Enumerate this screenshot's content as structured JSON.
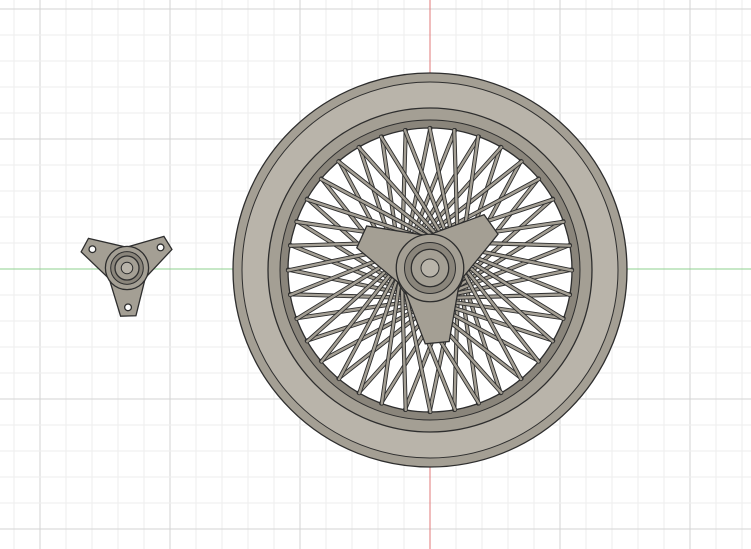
{
  "viewport": {
    "background": "#ffffff",
    "grid_minor_color": "#eeeeee",
    "grid_major_color": "#d3d3d3",
    "x_axis_color": "#8fd08f",
    "y_axis_color": "#e07a7a"
  },
  "materials": {
    "part_fill": "#a49f94",
    "part_fill_light": "#b9b4aa",
    "part_fill_dark": "#8a857b",
    "edge_color": "#2e2e2e"
  },
  "scene": {
    "objects": [
      {
        "name": "wheel-rim",
        "type": "wire-spoke-wheel"
      },
      {
        "name": "knock-off-spinner",
        "type": "three-ear-spinner"
      }
    ]
  }
}
